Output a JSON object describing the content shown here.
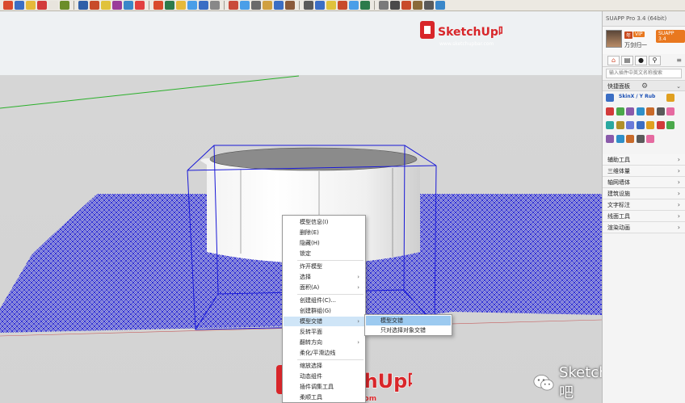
{
  "app": {
    "toolbar_icon_colors": [
      "#d94a2c",
      "#3b6ec4",
      "#e5b93a",
      "#d23a3a",
      "#e8e4dd",
      "#6b8d2a",
      "#2f5fa8",
      "#c84b2b",
      "#e0c23c",
      "#9a3c9a",
      "#3a87c9",
      "#e23f3f",
      "#d94a2c",
      "#2d7a4b",
      "#e5b93a",
      "#4a9ee8",
      "#3b6ec4",
      "#888888",
      "#c94a3a",
      "#4a9ee8",
      "#6a6a6a",
      "#d0a040",
      "#3b6ec4",
      "#8a5a3a",
      "#5a5a5a",
      "#3b6ec4",
      "#e0c23c",
      "#c84b2b",
      "#4a9ee8",
      "#2d7a4b",
      "#7a7a7a",
      "#4a4a4a",
      "#c84b2b",
      "#8a6a3a",
      "#5a5a5a",
      "#3a87c9"
    ]
  },
  "watermark": {
    "top_text": "SketchUp吧",
    "top_url": "www.sketchupbar.com",
    "bottom_text": "SketchUp吧",
    "bottom_url": "sketchupbar.com",
    "brand_color": "#d8262a"
  },
  "wechat": {
    "label": "SketchUp吧",
    "icon": "wechat-icon"
  },
  "context_menu": {
    "items": [
      {
        "label": "模型信息(I)",
        "submenu": false
      },
      {
        "label": "删除(E)",
        "submenu": false
      },
      {
        "label": "隐藏(H)",
        "submenu": false
      },
      {
        "label": "锁定",
        "submenu": false
      },
      {
        "label": "炸开模型",
        "submenu": false
      },
      {
        "label": "选择",
        "submenu": true
      },
      {
        "label": "面积(A)",
        "submenu": true
      },
      {
        "label": "创建组件(C)...",
        "submenu": false
      },
      {
        "label": "创建群组(G)",
        "submenu": false
      },
      {
        "label": "模型交错",
        "submenu": true,
        "active": true
      },
      {
        "label": "反转平面",
        "submenu": false
      },
      {
        "label": "翻转方向",
        "submenu": true
      },
      {
        "label": "柔化/平滑边线",
        "submenu": false
      },
      {
        "label": "缩放选择",
        "submenu": false
      },
      {
        "label": "动态组件",
        "submenu": false
      },
      {
        "label": "插件调集工具",
        "submenu": false
      },
      {
        "label": "柔顺工具",
        "submenu": false
      }
    ],
    "submenu_items": [
      "模型交错",
      "只对选择对象交错"
    ]
  },
  "panel": {
    "title": "SUAPP Pro 3.4 (64bit)",
    "user_name": "万剑归一",
    "level_badge": "年",
    "vip_badge": "VIP",
    "brand_badge": "SUAPP 3.4",
    "search_placeholder": "输入插件中英文名称搜索",
    "quick_label": "快捷面板",
    "quick_title": "SkinX / Y Rub",
    "tabs": [
      "home-icon",
      "list-icon",
      "user-icon",
      "search-icon"
    ],
    "categories": [
      "辅助工具",
      "三维体量",
      "轴网墙体",
      "建筑设施",
      "文字标注",
      "线面工具",
      "渲染动画"
    ]
  }
}
